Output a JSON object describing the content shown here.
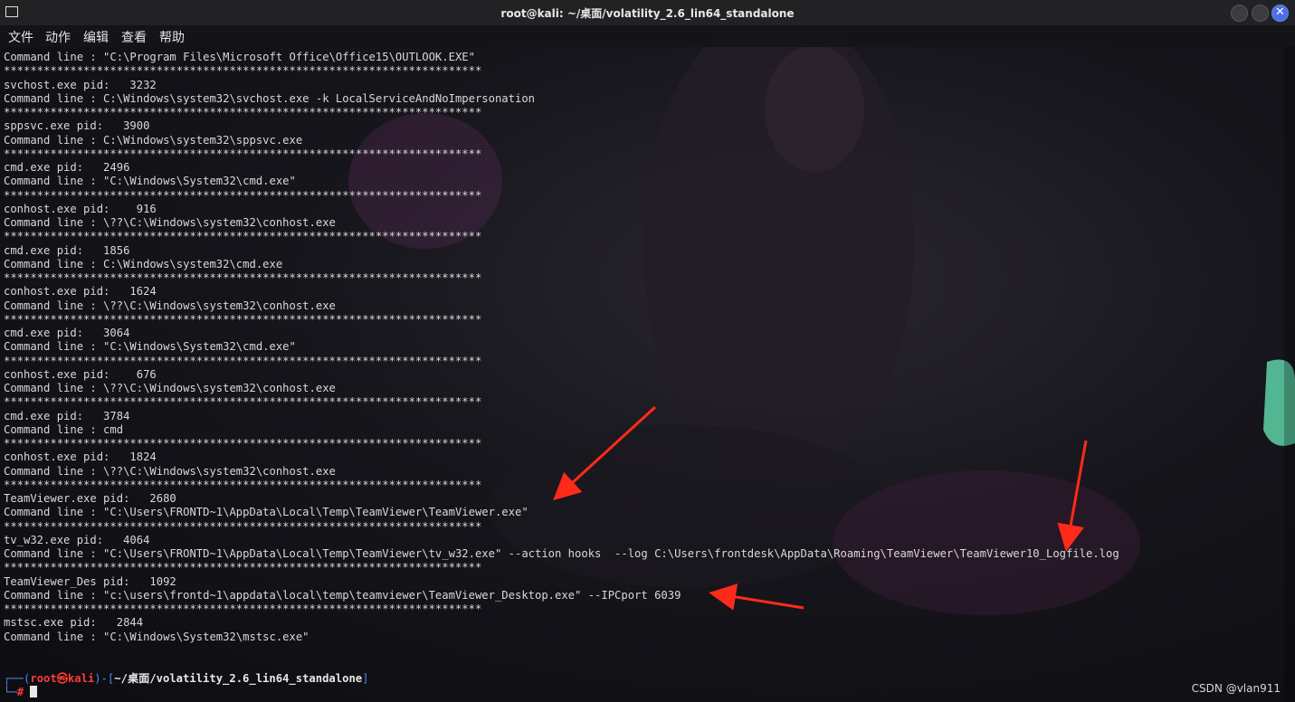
{
  "window": {
    "title": "root@kali: ~/桌面/volatility_2.6_lin64_standalone",
    "close_glyph": "✕"
  },
  "menu": [
    "文件",
    "动作",
    "编辑",
    "查看",
    "帮助"
  ],
  "terminal": {
    "lines": [
      "Command line : \"C:\\Program Files\\Microsoft Office\\Office15\\OUTLOOK.EXE\"",
      "************************************************************************",
      "svchost.exe pid:   3232",
      "Command line : C:\\Windows\\system32\\svchost.exe -k LocalServiceAndNoImpersonation",
      "************************************************************************",
      "sppsvc.exe pid:   3900",
      "Command line : C:\\Windows\\system32\\sppsvc.exe",
      "************************************************************************",
      "cmd.exe pid:   2496",
      "Command line : \"C:\\Windows\\System32\\cmd.exe\"",
      "************************************************************************",
      "conhost.exe pid:    916",
      "Command line : \\??\\C:\\Windows\\system32\\conhost.exe",
      "************************************************************************",
      "cmd.exe pid:   1856",
      "Command line : C:\\Windows\\system32\\cmd.exe",
      "************************************************************************",
      "conhost.exe pid:   1624",
      "Command line : \\??\\C:\\Windows\\system32\\conhost.exe",
      "************************************************************************",
      "cmd.exe pid:   3064",
      "Command line : \"C:\\Windows\\System32\\cmd.exe\"",
      "************************************************************************",
      "conhost.exe pid:    676",
      "Command line : \\??\\C:\\Windows\\system32\\conhost.exe",
      "************************************************************************",
      "cmd.exe pid:   3784",
      "Command line : cmd",
      "************************************************************************",
      "conhost.exe pid:   1824",
      "Command line : \\??\\C:\\Windows\\system32\\conhost.exe",
      "************************************************************************",
      "TeamViewer.exe pid:   2680",
      "Command line : \"C:\\Users\\FRONTD~1\\AppData\\Local\\Temp\\TeamViewer\\TeamViewer.exe\"",
      "************************************************************************",
      "tv_w32.exe pid:   4064",
      "Command line : \"C:\\Users\\FRONTD~1\\AppData\\Local\\Temp\\TeamViewer\\tv_w32.exe\" --action hooks  --log C:\\Users\\frontdesk\\AppData\\Roaming\\TeamViewer\\TeamViewer10_Logfile.log",
      "************************************************************************",
      "TeamViewer_Des pid:   1092",
      "Command line : \"c:\\users\\frontd~1\\appdata\\local\\temp\\teamviewer\\TeamViewer_Desktop.exe\" --IPCport 6039",
      "************************************************************************",
      "mstsc.exe pid:   2844",
      "Command line : \"C:\\Windows\\System32\\mstsc.exe\""
    ]
  },
  "prompt": {
    "open": "┌──(",
    "user": "root㉿kali",
    "mid": ")-[",
    "path": "~/桌面/volatility_2.6_lin64_standalone",
    "close": "]",
    "line2": "└─",
    "symbol": "#"
  },
  "watermark": "CSDN @vlan911",
  "colors": {
    "arrow": "#ff2a1a",
    "prompt_frame": "#4b8bf0",
    "prompt_user": "#ff3b3b",
    "close_button": "#4d6ee6"
  }
}
